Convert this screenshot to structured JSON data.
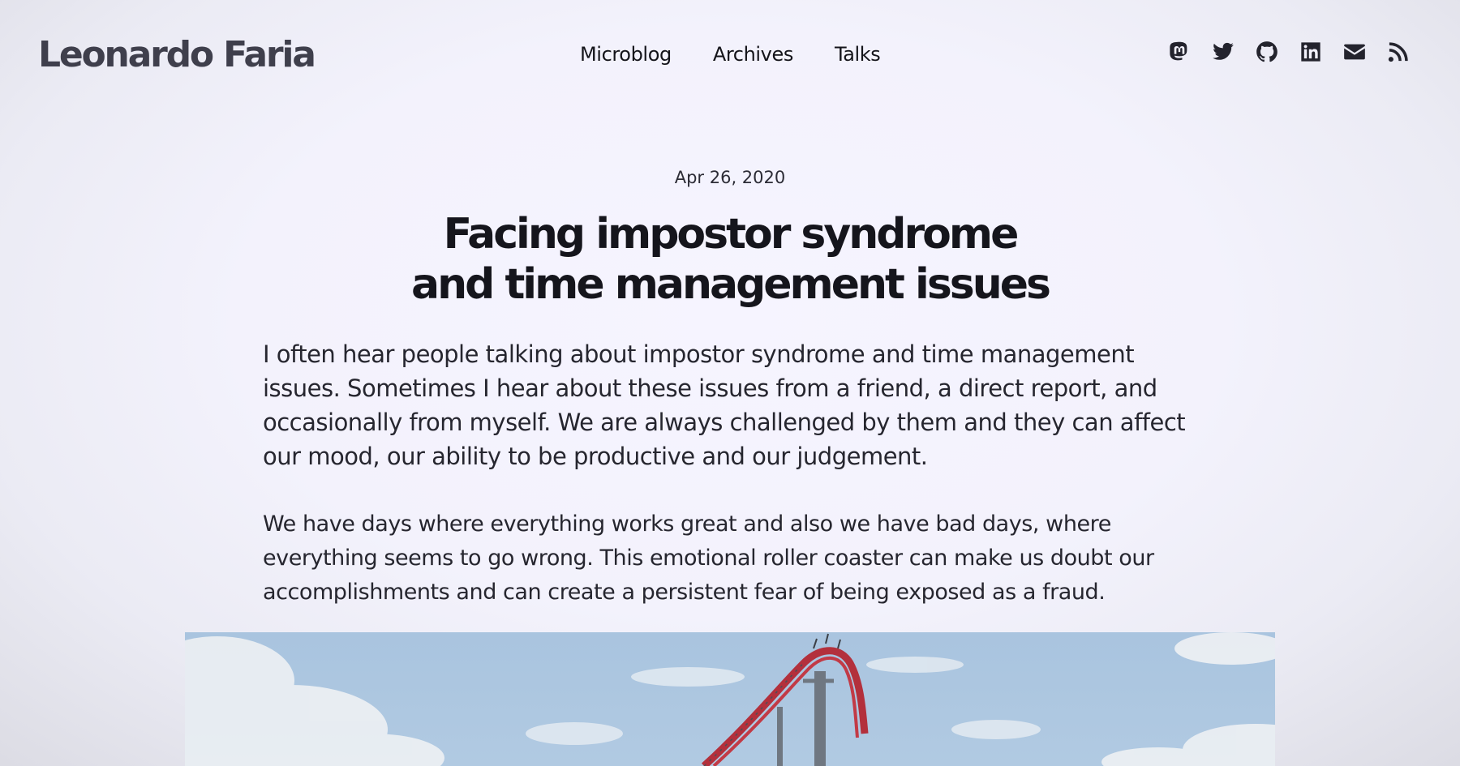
{
  "header": {
    "site_title": "Leonardo Faria",
    "nav": [
      {
        "label": "Microblog"
      },
      {
        "label": "Archives"
      },
      {
        "label": "Talks"
      }
    ],
    "social": [
      {
        "name": "mastodon-icon"
      },
      {
        "name": "twitter-icon"
      },
      {
        "name": "github-icon"
      },
      {
        "name": "linkedin-icon"
      },
      {
        "name": "email-icon"
      },
      {
        "name": "rss-icon"
      }
    ]
  },
  "post": {
    "date": "Apr 26, 2020",
    "title_line1": "Facing impostor syndrome",
    "title_line2": "and time management issues",
    "lead": "I often hear people talking about impostor syndrome and time management issues. Sometimes I hear about these issues from a friend, a direct report, and occasionally from myself. We are always challenged by them and they can affect our mood, our ability to be productive and our judgement.",
    "paragraph": "We have days where everything works great and also we have bad days, where everything seems to go wrong. This emotional roller coaster can make us doubt our accomplishments and can create a persistent fear of being exposed as a fraud."
  },
  "colors": {
    "text": "#26262f",
    "site_title": "#3f3f4c",
    "icon": "#23232d",
    "coaster_track": "#b3303c",
    "sky": "#aec8e1"
  }
}
